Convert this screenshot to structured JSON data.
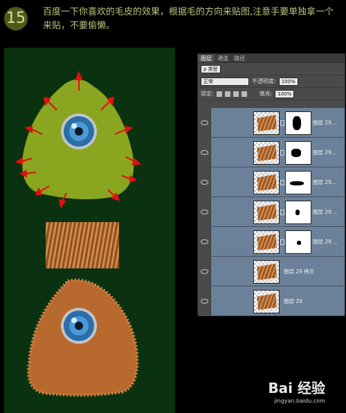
{
  "step": {
    "number": "15"
  },
  "instruction": "百度一下你喜欢的毛皮的效果，根据毛的方向来贴图,注意手要单独拿一个来贴，不要偷懒。",
  "panel": {
    "tabs": [
      "图层",
      "通道",
      "路径"
    ],
    "filter_label": "ρ 类型",
    "blend_mode": "正常",
    "opacity_label": "不透明度:",
    "opacity_value": "100%",
    "lock_label": "锁定:",
    "fill_label": "填充:",
    "fill_value": "100%",
    "layers": [
      {
        "name": "图层 29..."
      },
      {
        "name": "图层 29..."
      },
      {
        "name": "图层 29..."
      },
      {
        "name": "图层 29 ..."
      },
      {
        "name": "图层 29 ..."
      },
      {
        "name": "图层 29 拷贝"
      },
      {
        "name": "图层 29"
      }
    ]
  },
  "watermark": {
    "logo": "Bai 经验",
    "url": "jingyan.baidu.com"
  },
  "colors": {
    "canvas_bg": "#0a3210",
    "monster_green": "#8aa51f",
    "arrow": "#e01010",
    "fur": "#b86a2e",
    "layer_selected": "#6b8199"
  }
}
